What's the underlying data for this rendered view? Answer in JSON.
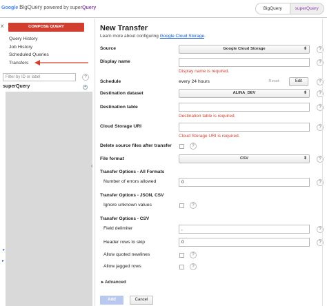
{
  "brand": {
    "google": "Google",
    "product": "BigQuery",
    "powered": "powered by super",
    "query": "Query"
  },
  "top_tabs": [
    "BigQuery",
    "superQuery"
  ],
  "sidebar": {
    "close": "X",
    "compose": "COMPOSE QUERY",
    "items": [
      {
        "label": "Query History"
      },
      {
        "label": "Job History"
      },
      {
        "label": "Scheduled Queries"
      },
      {
        "label": "Transfers"
      }
    ],
    "filter_placeholder": "Filter by ID or label",
    "project": "superQuery",
    "collapse": "‹"
  },
  "main": {
    "title": "New Transfer",
    "learn_prefix": "Learn more about configuring ",
    "learn_link": "Google Cloud Storage",
    "learn_suffix": ".",
    "source_label": "Source",
    "source_value": "Google Cloud Storage",
    "display_name_label": "Display name",
    "display_name_error": "Display name is required.",
    "schedule_label": "Schedule",
    "schedule_value": "every 24 hours",
    "reset": "Reset",
    "edit": "Edit",
    "dest_dataset_label": "Destination dataset",
    "dest_dataset_value": "ALINA_DEV",
    "dest_table_label": "Destination table",
    "dest_table_error": "Destination table is required.",
    "gcs_uri_label": "Cloud Storage URI",
    "gcs_uri_error": "Cloud Storage URI is required.",
    "delete_label": "Delete source files after transfer",
    "file_format_label": "File format",
    "file_format_value": "CSV",
    "section_all": "Transfer Options - All Formats",
    "errors_allowed_label": "Number of errors allowed",
    "errors_allowed_value": "0",
    "section_json_csv": "Transfer Options - JSON, CSV",
    "ignore_unknown_label": "Ignore unknown values",
    "section_csv": "Transfer Options - CSV",
    "field_delim_label": "Field delimiter",
    "field_delim_value": ",",
    "header_rows_label": "Header rows to skip",
    "header_rows_value": "0",
    "quoted_newlines_label": "Allow quoted newlines",
    "jagged_rows_label": "Allow jagged rows",
    "advanced": "▸ Advanced",
    "add": "Add",
    "cancel": "Cancel",
    "help": "?"
  },
  "colors": {
    "compose": "#d23f31",
    "error": "#d23f31",
    "link": "#1155cc",
    "add_disabled": "#b9c8ee"
  }
}
